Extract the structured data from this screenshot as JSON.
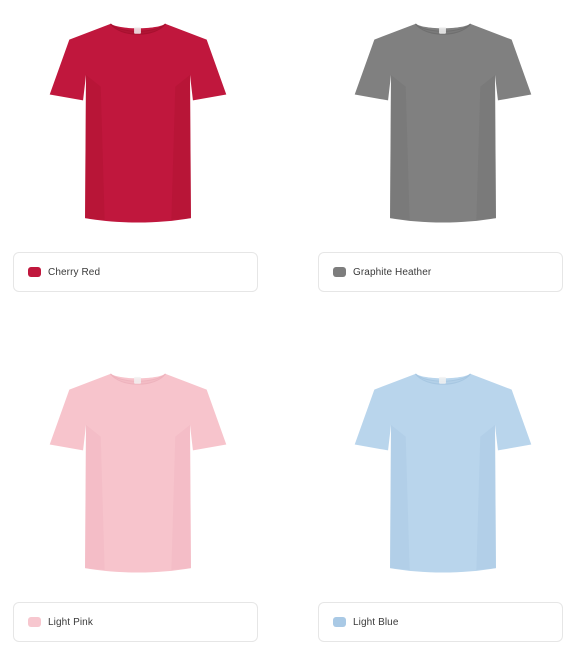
{
  "products": [
    {
      "color_name": "Cherry Red",
      "fill": "#c0173d",
      "shade": "#a8102f",
      "collar": "#b01535",
      "chip": "#c0173d",
      "tag_visible": true
    },
    {
      "color_name": "Graphite Heather",
      "fill": "#808080",
      "shade": "#6f6f6f",
      "collar": "#7a7a7a",
      "chip": "#7d7d7d",
      "tag_visible": true
    },
    {
      "color_name": "Light Pink",
      "fill": "#f7c4cc",
      "shade": "#eeb3bd",
      "collar": "#f3bcc5",
      "chip": "#f7c7cf",
      "tag_visible": true
    },
    {
      "color_name": "Light Blue",
      "fill": "#b9d5ec",
      "shade": "#a7c7e2",
      "collar": "#b3d0e8",
      "chip": "#a9c9e5",
      "tag_visible": true
    }
  ],
  "icons": {
    "shirt": "tshirt-icon",
    "chip": "color-chip-icon"
  }
}
